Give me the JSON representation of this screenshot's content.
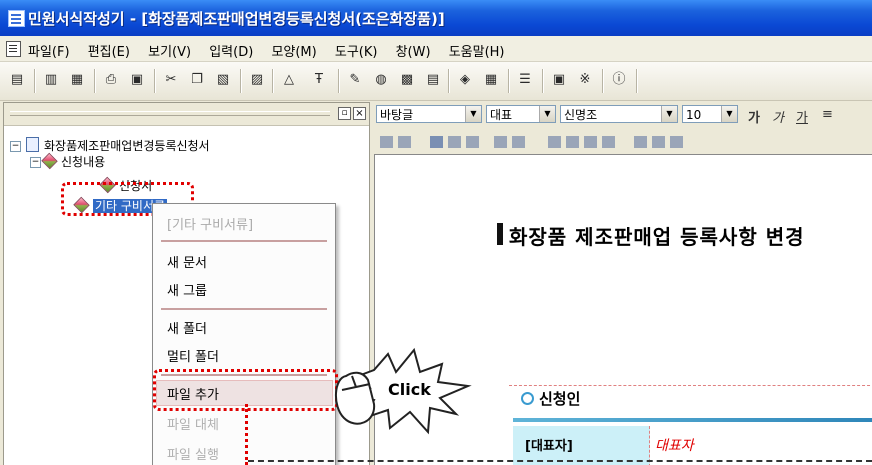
{
  "window": {
    "title": "민원서식작성기 - [화장품제조판매업변경등록신청서(조은화장품)]"
  },
  "menu": {
    "items": [
      "파일(F)",
      "편집(E)",
      "보기(V)",
      "입력(D)",
      "모양(M)",
      "도구(K)",
      "창(W)",
      "도움말(H)"
    ]
  },
  "toolbar": {
    "icons": [
      "new-doc-icon",
      "open-icon",
      "save-icon",
      "print-icon",
      "preview-icon",
      "cut-icon",
      "copy-icon",
      "paste-icon",
      "folder-icon",
      "shape-icon",
      "bold-icon",
      "pen-icon",
      "counter-icon",
      "insert-icon",
      "image-icon",
      "arrow-icon",
      "table-icon",
      "chart-icon",
      "symbol-icon",
      "info-icon"
    ]
  },
  "tree": {
    "root": "화장품제조판매업변경등록신청서",
    "group": "신청내용",
    "child": "신청서",
    "selected": "기타 구비서류"
  },
  "context_menu": {
    "header": "[기타 구비서류]",
    "items": [
      "새 문서",
      "새 그룹",
      "새 폴더",
      "멀티 폴더",
      "파일 추가",
      "파일 대체",
      "파일 실행"
    ],
    "highlighted": "파일 추가"
  },
  "format_bar": {
    "style": "바탕글",
    "text_type": "대표",
    "font": "신명조",
    "size": "10",
    "bold": "가",
    "italic": "가",
    "underline": "가"
  },
  "document": {
    "title": "화장품 제조판매업 등록사항 변경",
    "section_title": "신청인",
    "field_label": "[대표자]",
    "field_value": "대표자"
  },
  "callout": {
    "text": "Click"
  }
}
